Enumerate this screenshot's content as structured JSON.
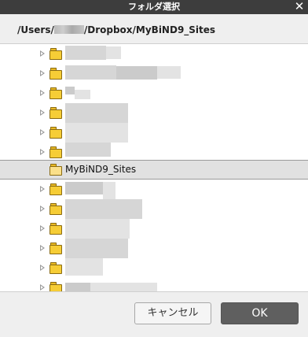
{
  "dialog": {
    "title": "フォルダ選択",
    "close_icon": "close-icon"
  },
  "path": {
    "prefix": "/Users/",
    "suffix": "/Dropbox/MyBiND9_Sites"
  },
  "tree": {
    "selected_label": "MyBiND9_Sites"
  },
  "buttons": {
    "cancel": "キャンセル",
    "ok": "OK"
  },
  "colors": {
    "titlebar": "#3d3d3d",
    "folder": "#f6cd36",
    "ok_button": "#5f5f5f"
  }
}
